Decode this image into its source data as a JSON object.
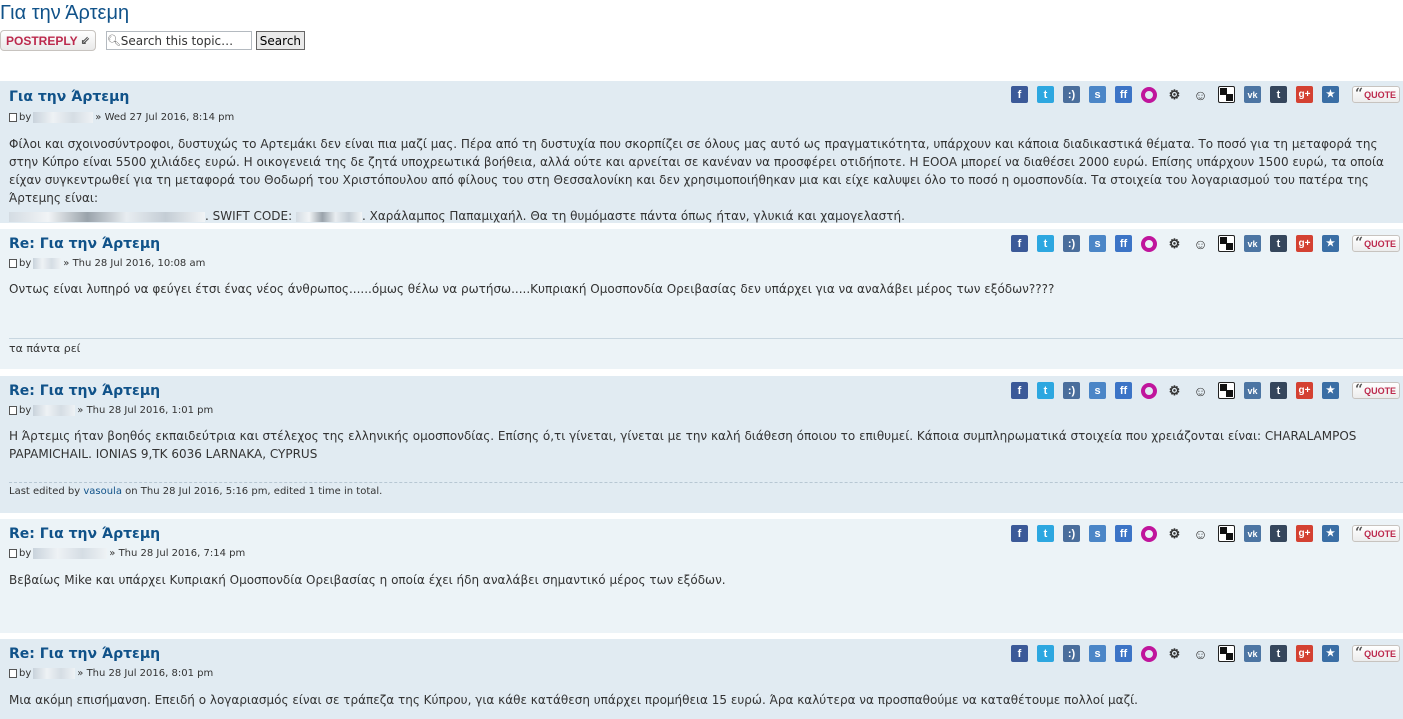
{
  "topic": {
    "title": "Για την Άρτεμη",
    "post_reply_label": "POSTREPLY",
    "search_placeholder": "Search this topic…",
    "search_button": "Search"
  },
  "share_icons": [
    "facebook-icon",
    "twitter-icon",
    "delicious-icon",
    "stumbleupon-icon",
    "friendfeed-icon",
    "oknotizie-icon",
    "digg-icon",
    "reddit-icon",
    "diigo-icon",
    "vk-icon",
    "tumblr-icon",
    "google-plus-icon",
    "google-bookmarks-icon"
  ],
  "quote_label": "QUOTE",
  "posts": [
    {
      "title": "Για την Άρτεμη",
      "by": "by",
      "date": "» Wed 27 Jul 2016, 8:14 pm",
      "content_main": "Φίλοι και σχοινοσύντροφοι, δυστυχώς το Αρτεμάκι δεν είναι πια μαζί μας. Πέρα από τη δυστυχία που σκορπίζει σε όλους μας αυτό ως πραγματικότητα, υπάρχουν και κάποια διαδικαστικά θέματα. Το ποσό για τη μεταφορά της στην Κύπρο είναι 5500 χιλιάδες ευρώ. Η οικογενειά της δε ζητά υποχρεωτικά βοήθεια, αλλά ούτε και αρνείται σε κανέναν να προσφέρει οτιδήποτε. Η ΕΟΟΑ μπορεί να διαθέσει 2000 ευρώ. Επίσης υπάρχουν 1500 ευρώ, τα οποία είχαν συγκεντρωθεί για τη μεταφορά του Θοδωρή του Χριστόπουλου από φίλους του στη Θεσσαλονίκη και δεν χρησιμοποιήθηκαν μια και είχε καλυψει όλο το ποσό η ομοσπονδία. Τα στοιχεία του λογαριασμού του πατέρα της Άρτεμης είναι:",
      "content_swift": ". SWIFT CODE:",
      "content_end": ". Χαράλαμπος Παπαμιχαήλ. Θα τη θυμόμαστε πάντα όπως ήταν, γλυκιά και χαμογελαστή."
    },
    {
      "title": "Re: Για την Άρτεμη",
      "by": "by",
      "date": "» Thu 28 Jul 2016, 10:08 am",
      "content": "Οντως είναι λυπηρό να φεύγει έτσι ένας νέος άνθρωπος......όμως θέλω να ρωτήσω.....Κυπριακή Ομοσπονδία Ορειβασίας δεν υπάρχει για να αναλάβει μέρος των εξόδων????",
      "signature": "τα πάντα ρεί"
    },
    {
      "title": "Re: Για την Άρτεμη",
      "by": "by",
      "date": "» Thu 28 Jul 2016, 1:01 pm",
      "content": "Η Άρτεμις ήταν βοηθός εκπαιδεύτρια και στέλεχος της ελληνικής ομοσπονδίας. Επίσης ό,τι γίνεται, γίνεται με την καλή διάθεση όποιου το επιθυμεί. Κάποια συμπληρωματικά στοιχεία που χρειάζονται είναι: CHARALAMPOS PAPAMICHAIL. IONIAS 9,TK 6036 LARNAKA, CYPRUS",
      "edited_prefix": "Last edited by",
      "edited_user": "vasoula",
      "edited_suffix": "on Thu 28 Jul 2016, 5:16 pm, edited 1 time in total."
    },
    {
      "title": "Re: Για την Άρτεμη",
      "by": "by",
      "date": "» Thu 28 Jul 2016, 7:14 pm",
      "content": "Βεβαίως Mike και υπάρχει Κυπριακή Ομοσπονδία Ορειβασίας η οποία έχει ήδη αναλάβει σημαντικό μέρος των εξόδων."
    },
    {
      "title": "Re: Για την Άρτεμη",
      "by": "by",
      "date": "» Thu 28 Jul 2016, 8:01 pm",
      "content": "Μια ακόμη επισήμανση. Επειδή ο λογαριασμός είναι σε τράπεζα της Κύπρου, για κάθε κατάθεση υπάρχει προμήθεια 15 ευρώ. Άρα καλύτερα να προσπαθούμε να καταθέτουμε πολλοί μαζί."
    }
  ]
}
